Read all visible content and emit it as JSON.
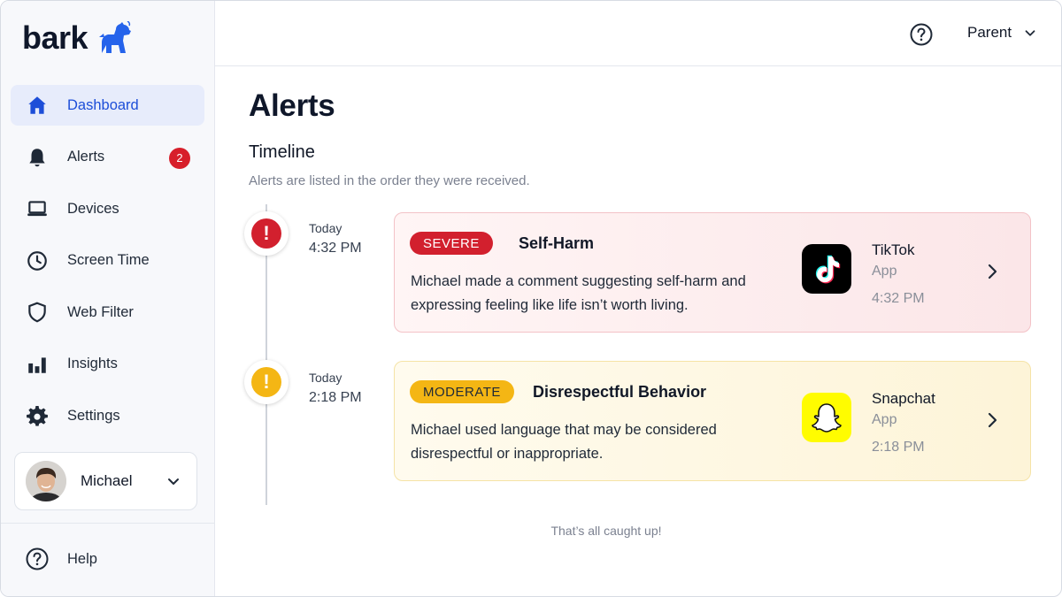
{
  "brand": {
    "name": "bark"
  },
  "sidebar": {
    "items": [
      {
        "label": "Dashboard",
        "icon": "home-icon",
        "active": true
      },
      {
        "label": "Alerts",
        "icon": "bell-icon",
        "badge": "2"
      },
      {
        "label": "Devices",
        "icon": "laptop-icon"
      },
      {
        "label": "Screen Time",
        "icon": "clock-icon"
      },
      {
        "label": "Web Filter",
        "icon": "shield-icon"
      },
      {
        "label": "Insights",
        "icon": "bar-chart-icon"
      },
      {
        "label": "Settings",
        "icon": "gear-icon"
      }
    ],
    "child": {
      "name": "Michael"
    },
    "help_label": "Help"
  },
  "header": {
    "user_label": "Parent"
  },
  "main": {
    "title": "Alerts",
    "section_title": "Timeline",
    "section_subtitle": "Alerts are listed in the order they were received.",
    "alerts": [
      {
        "day": "Today",
        "time": "4:32 PM",
        "severity": "SEVERE",
        "title": "Self-Harm",
        "description": "Michael made a comment suggesting self-harm and expressing feeling like life isn’t worth living.",
        "app_name": "TikTok",
        "app_type": "App",
        "app_time": "4:32 PM",
        "color": "#d2202e"
      },
      {
        "day": "Today",
        "time": "2:18 PM",
        "severity": "MODERATE",
        "title": "Disrespectful Behavior",
        "description": "Michael used language that may be considered disrespectful or inappropriate.",
        "app_name": "Snapchat",
        "app_type": "App",
        "app_time": "2:18 PM",
        "color": "#f4b614"
      }
    ],
    "footer_note": "That’s all caught up!"
  },
  "colors": {
    "accent": "#1d4ed8",
    "severe": "#d2202e",
    "moderate": "#f4b614",
    "badge": "#d71f2b"
  }
}
